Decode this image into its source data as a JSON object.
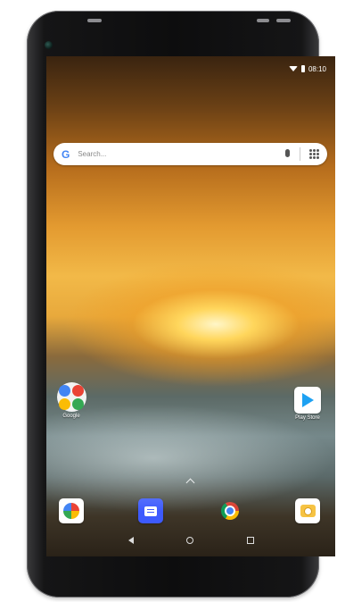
{
  "status_bar": {
    "time": "08:10"
  },
  "search": {
    "placeholder": "Search...",
    "logo": "G"
  },
  "apps": {
    "google_label": "Google",
    "playstore_label": "Play Store"
  },
  "dock": [
    "pinwheel-icon",
    "messages-icon",
    "chrome-icon",
    "camera-icon"
  ],
  "colors": {
    "search_bg": "#ffffff",
    "messages_blue": "#3d5afe",
    "play_blue": "#1da1f2"
  }
}
